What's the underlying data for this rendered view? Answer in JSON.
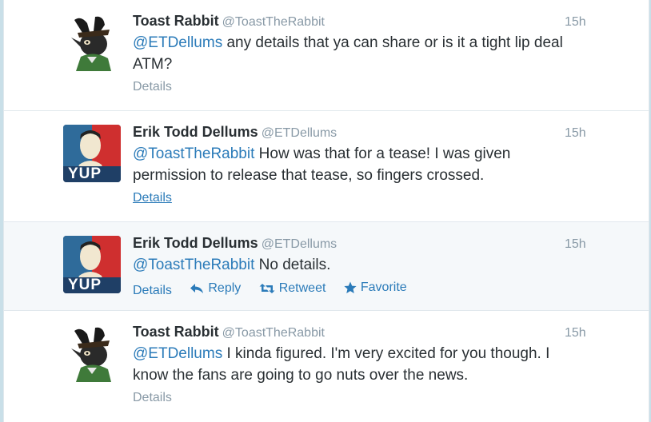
{
  "tweets": [
    {
      "fullname": "Toast Rabbit",
      "username": "@ToastTheRabbit",
      "time": "15h",
      "mention": "@ETDellums",
      "text": " any details that ya can share or is it a tight lip deal ATM?",
      "details": "Details",
      "avatar_icon": "rabbit-avatar"
    },
    {
      "fullname": "Erik Todd Dellums",
      "username": "@ETDellums",
      "time": "15h",
      "mention": "@ToastTheRabbit",
      "text": " How was that for a tease! I was given permission to release that tease, so fingers crossed.",
      "details": "Details",
      "avatar_icon": "yup-poster-avatar",
      "avatar_text": "YUP"
    },
    {
      "fullname": "Erik Todd Dellums",
      "username": "@ETDellums",
      "time": "15h",
      "mention": "@ToastTheRabbit",
      "text": " No details.",
      "details": "Details",
      "reply": "Reply",
      "retweet": "Retweet",
      "favorite": "Favorite",
      "avatar_icon": "yup-poster-avatar",
      "avatar_text": "YUP"
    },
    {
      "fullname": "Toast Rabbit",
      "username": "@ToastTheRabbit",
      "time": "15h",
      "mention": "@ETDellums",
      "text": " I kinda figured. I'm very excited for you though. I know the fans are going to go nuts over the news.",
      "details": "Details",
      "avatar_icon": "rabbit-avatar"
    }
  ],
  "colors": {
    "link": "#2b7bb9",
    "muted": "#8899a6",
    "text": "#292f33",
    "divider": "#e1e8ed"
  }
}
